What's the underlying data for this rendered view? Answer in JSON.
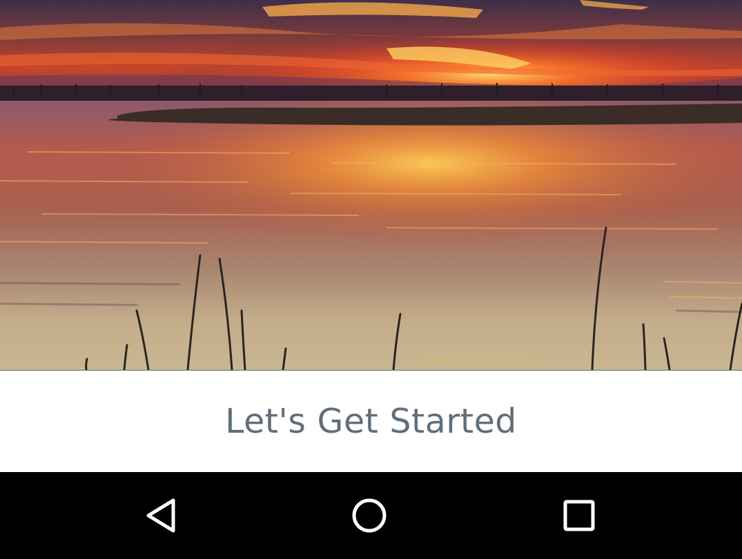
{
  "hero": {
    "image": "sunset-over-marsh-lake"
  },
  "cta": {
    "label": "Let's Get Started"
  },
  "navbar": {
    "back_icon": "back-triangle-icon",
    "home_icon": "home-circle-icon",
    "recents_icon": "recents-square-icon"
  },
  "colors": {
    "cta_text": "#5f6f7c",
    "navbar_bg": "#000000",
    "nav_icon": "#ffffff"
  }
}
